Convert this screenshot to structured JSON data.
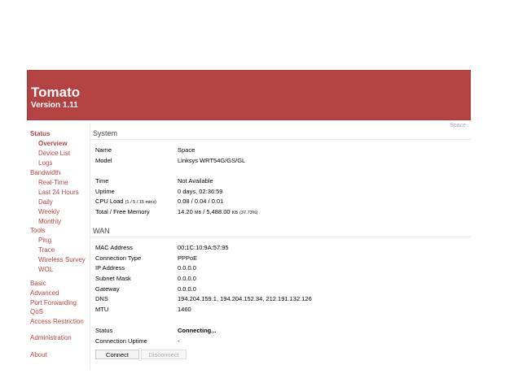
{
  "header": {
    "title": "Tomato",
    "version": "Version 1.11",
    "router_name": "Space"
  },
  "nav": {
    "status": "Status",
    "overview": "Overview",
    "device_list": "Device List",
    "logs": "Logs",
    "bandwidth": "Bandwidth",
    "real_time": "Real-Time",
    "last_24": "Last 24 Hours",
    "daily": "Daily",
    "weekly": "Weekly",
    "monthly": "Monthly",
    "tools": "Tools",
    "ping": "Ping",
    "trace": "Trace",
    "wireless_survey": "Wireless Survey",
    "wol": "WOL",
    "basic": "Basic",
    "advanced": "Advanced",
    "port_forwarding": "Port Forwarding",
    "qos": "QoS",
    "access_restriction": "Access Restriction",
    "administration": "Administration",
    "about": "About"
  },
  "system": {
    "title": "System",
    "name_label": "Name",
    "name": "Space",
    "model_label": "Model",
    "model": "Linksys WRT54G/GS/GL",
    "time_label": "Time",
    "time": "Not Available",
    "uptime_label": "Uptime",
    "uptime": "0 days, 02:36:59",
    "cpu_label": "CPU Load",
    "cpu_sub": "(1 / 5 / 15 mins)",
    "cpu": "0.08 / 0.04 / 0.01",
    "mem_label": "Total / Free Memory",
    "mem_a": "14.20",
    "mem_unit1": "MB",
    "mem_b": " / 5,488.00 ",
    "mem_unit2": "KB",
    "mem_pct": "(37.73%)"
  },
  "wan": {
    "title": "WAN",
    "mac_label": "MAC Address",
    "mac": "00:1C:10:9A:57:95",
    "conn_type_label": "Connection Type",
    "conn_type": "PPPoE",
    "ip_label": "IP Address",
    "ip": "0.0.0.0",
    "mask_label": "Subnet Mask",
    "mask": "0.0.0.0",
    "gw_label": "Gateway",
    "gw": "0.0.0.0",
    "dns_label": "DNS",
    "dns": "194.204.159.1, 194.204.152.34, 212.191.132.126",
    "mtu_label": "MTU",
    "mtu": "1460",
    "status_label": "Status",
    "status": "Connecting...",
    "conn_uptime_label": "Connection Uptime",
    "conn_uptime": "-",
    "connect_btn": "Connect",
    "disconnect_btn": "Disconnect"
  }
}
